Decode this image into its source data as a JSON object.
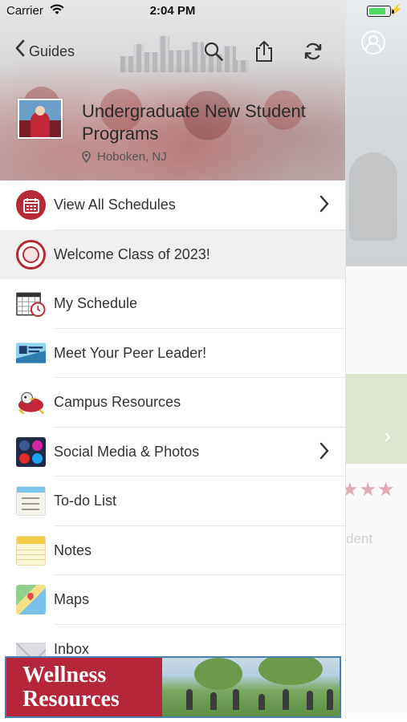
{
  "status_bar": {
    "carrier": "Carrier",
    "time": "2:04 PM",
    "battery_level": 0.85,
    "wifi_icon": "wifi-icon",
    "charging_icon": "bolt-icon"
  },
  "nav": {
    "back_label": "Guides",
    "icons": [
      "search-icon",
      "share-icon",
      "refresh-icon"
    ]
  },
  "guide": {
    "title": "Undergraduate New Student Programs",
    "location": "Hoboken, NJ"
  },
  "menu": {
    "items": [
      {
        "label": "View All Schedules",
        "icon": "calendar-icon",
        "chevron": true,
        "active": false
      },
      {
        "label": "Welcome Class of 2023!",
        "icon": "seal-icon",
        "chevron": false,
        "active": true
      },
      {
        "label": "My Schedule",
        "icon": "schedule-clock-icon",
        "chevron": false,
        "active": false
      },
      {
        "label": "Meet Your Peer Leader!",
        "icon": "peer-leaders-icon",
        "chevron": false,
        "active": false
      },
      {
        "label": "Campus Resources",
        "icon": "mascot-icon",
        "chevron": false,
        "active": false
      },
      {
        "label": "Social Media & Photos",
        "icon": "social-media-icon",
        "chevron": true,
        "active": false
      },
      {
        "label": "To-do List",
        "icon": "todo-list-icon",
        "chevron": false,
        "active": false
      },
      {
        "label": "Notes",
        "icon": "notes-icon",
        "chevron": false,
        "active": false
      },
      {
        "label": "Maps",
        "icon": "map-icon",
        "chevron": false,
        "active": false
      },
      {
        "label": "Inbox",
        "icon": "inbox-icon",
        "chevron": false,
        "active": false
      }
    ]
  },
  "banner": {
    "line1": "Wellness",
    "line2": "Resources"
  },
  "background": {
    "partial_text": "dent",
    "stars_shown": 3
  },
  "colors": {
    "brand_red": "#b5263a",
    "active_row": "#f0eff0",
    "banner_border": "#4a7fb0"
  }
}
